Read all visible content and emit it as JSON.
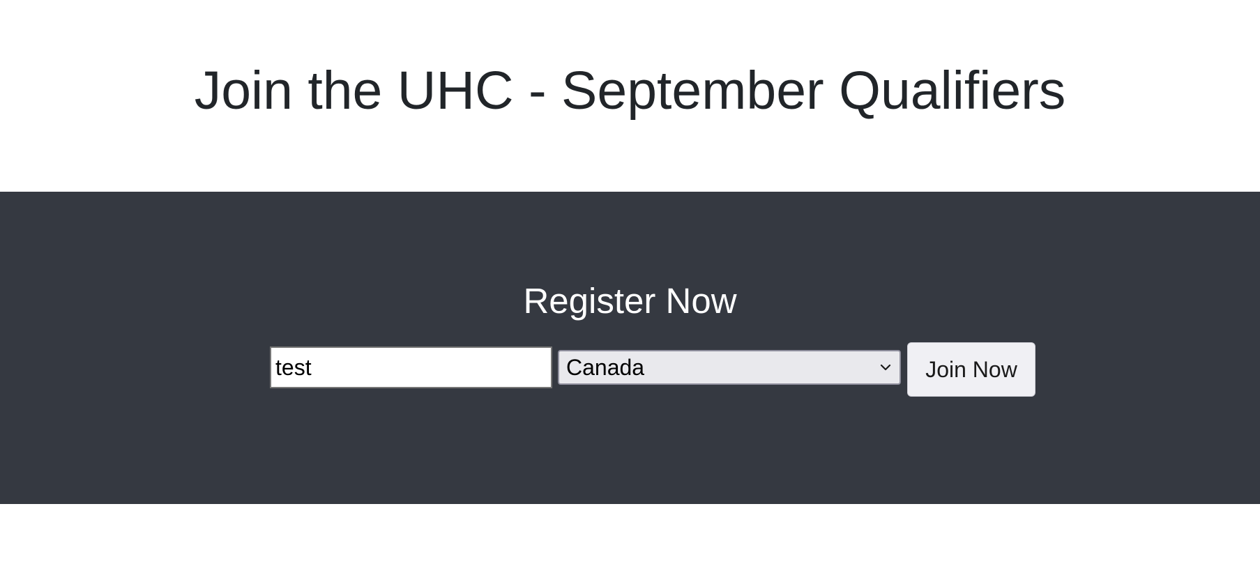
{
  "page": {
    "title": "Join the UHC - September Qualifiers"
  },
  "register": {
    "heading": "Register Now",
    "name_input": {
      "value": "test",
      "placeholder": ""
    },
    "country_select": {
      "selected": "Canada",
      "icon": "chevron-down-icon"
    },
    "join_button_label": "Join Now"
  },
  "colors": {
    "section_background": "#353941",
    "title_text": "#212529",
    "heading_text": "#ffffff",
    "button_background": "#f0f0f4",
    "select_background": "#e9e9ed"
  }
}
